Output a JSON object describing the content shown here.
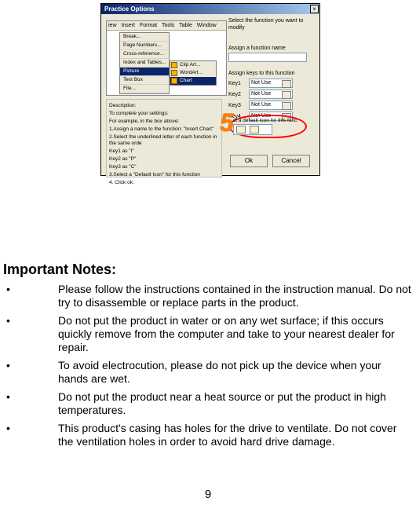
{
  "figure": {
    "dialog_title": "Practice Options",
    "close_glyph": "×",
    "menu_items": [
      "iew",
      "Insert",
      "Format",
      "Tools",
      "Table",
      "Window"
    ],
    "cascade1": [
      "Break...",
      "Page Numbers...",
      "Cross-reference...",
      "Index and Tables...",
      "Picture",
      "Text Box",
      "File..."
    ],
    "cascade1_selected_index": 4,
    "cascade2": [
      {
        "icon": "clipart",
        "label": "Clip Art..."
      },
      {
        "icon": "wordart",
        "label": "WordArt..."
      },
      {
        "icon": "chart",
        "label": "Chart"
      }
    ],
    "cascade2_selected_index": 2,
    "desc": {
      "heading": "Description:",
      "line1": "To complete your settings:",
      "line2": "For example, in the box above:",
      "step1": "1.Assign a name to the function: \"Insert Chart\"",
      "step2": "2.Select the underlined letter of each function in the same orde",
      "step2a": "Key1 as \"I\"",
      "step2b": "Key2 as \"P\"",
      "step2c": "Key3 as \"C\"",
      "step3": "3.Select a \"Default Icon\" for this function",
      "step4": "4. Click ok."
    },
    "right": {
      "l1": "Select the function you want to modify",
      "l2": "Assign a function name",
      "l3": "Assign keys to this function",
      "keys": [
        {
          "name": "Key1",
          "value": "Not Use"
        },
        {
          "name": "Key2",
          "value": "Not Use"
        },
        {
          "name": "Key3",
          "value": "Not Use"
        },
        {
          "name": "Key4",
          "value": "Not Use"
        }
      ],
      "icon_label": "ct a default  Icon for this func",
      "ok": "Ok",
      "cancel": "Cancel"
    },
    "annotation_number": "5"
  },
  "notes": {
    "title": "Important Notes:",
    "items": [
      "Please follow the instructions contained in the instruction manual.    Do not try to disassemble or replace parts in the product.",
      "Do not put the product in water or on any wet surface; if this occurs quickly remove from the computer and take to your nearest dealer for repair.",
      "To avoid electrocution, please do not pick up the device when your hands are wet.",
      "Do not put the product near a heat source or put the product in high temperatures.",
      "This product's casing has holes for the drive to ventilate. Do not cover the ventilation holes in order to avoid hard drive damage."
    ]
  },
  "page_number": "9"
}
